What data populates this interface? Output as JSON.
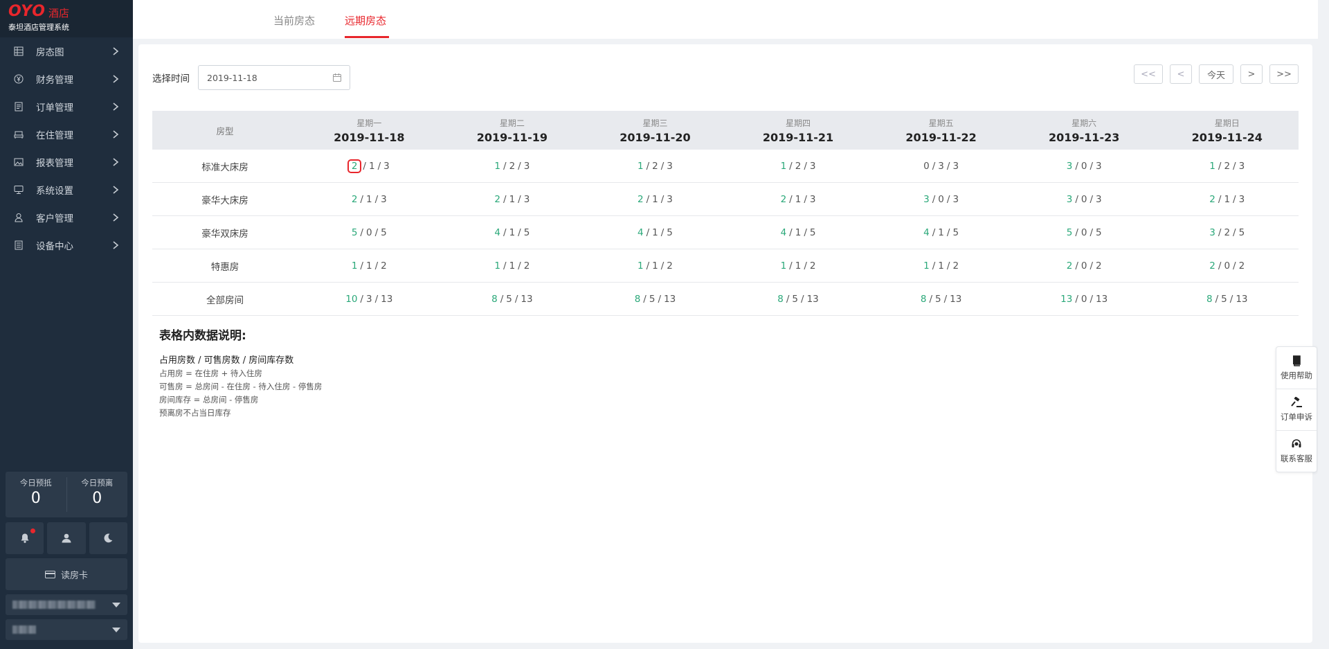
{
  "brand": {
    "logo_text": "OYO",
    "logo_suffix": "酒店",
    "subtitle": "泰坦酒店管理系统"
  },
  "sidebar": {
    "items": [
      {
        "label": "房态图",
        "icon": "grid-icon"
      },
      {
        "label": "财务管理",
        "icon": "yen-icon"
      },
      {
        "label": "订单管理",
        "icon": "document-icon"
      },
      {
        "label": "在住管理",
        "icon": "bed-icon"
      },
      {
        "label": "报表管理",
        "icon": "image-icon"
      },
      {
        "label": "系统设置",
        "icon": "monitor-icon"
      },
      {
        "label": "客户管理",
        "icon": "user-icon"
      },
      {
        "label": "设备中心",
        "icon": "list-icon"
      }
    ],
    "stats": {
      "checkin_label": "今日预抵",
      "checkin_value": "0",
      "checkout_label": "今日预离",
      "checkout_value": "0"
    },
    "read_card_label": "读房卡"
  },
  "tabs": [
    {
      "label": "当前房态",
      "active": false
    },
    {
      "label": "远期房态",
      "active": true
    }
  ],
  "toolbar": {
    "date_label": "选择时间",
    "date_value": "2019-11-18",
    "nav": {
      "first": "<<",
      "prev": "<",
      "today": "今天",
      "next": ">",
      "last": ">>"
    }
  },
  "table": {
    "type_header": "房型",
    "days": [
      {
        "weekday": "星期一",
        "date": "2019-11-18"
      },
      {
        "weekday": "星期二",
        "date": "2019-11-19"
      },
      {
        "weekday": "星期三",
        "date": "2019-11-20"
      },
      {
        "weekday": "星期四",
        "date": "2019-11-21"
      },
      {
        "weekday": "星期五",
        "date": "2019-11-22"
      },
      {
        "weekday": "星期六",
        "date": "2019-11-23"
      },
      {
        "weekday": "星期日",
        "date": "2019-11-24"
      }
    ],
    "rows": [
      {
        "type": "标准大床房",
        "cells": [
          [
            "2",
            "1",
            "3"
          ],
          [
            "1",
            "2",
            "3"
          ],
          [
            "1",
            "2",
            "3"
          ],
          [
            "1",
            "2",
            "3"
          ],
          [
            "0",
            "3",
            "3"
          ],
          [
            "3",
            "0",
            "3"
          ],
          [
            "1",
            "2",
            "3"
          ]
        ]
      },
      {
        "type": "豪华大床房",
        "cells": [
          [
            "2",
            "1",
            "3"
          ],
          [
            "2",
            "1",
            "3"
          ],
          [
            "2",
            "1",
            "3"
          ],
          [
            "2",
            "1",
            "3"
          ],
          [
            "3",
            "0",
            "3"
          ],
          [
            "3",
            "0",
            "3"
          ],
          [
            "2",
            "1",
            "3"
          ]
        ]
      },
      {
        "type": "豪华双床房",
        "cells": [
          [
            "5",
            "0",
            "5"
          ],
          [
            "4",
            "1",
            "5"
          ],
          [
            "4",
            "1",
            "5"
          ],
          [
            "4",
            "1",
            "5"
          ],
          [
            "4",
            "1",
            "5"
          ],
          [
            "5",
            "0",
            "5"
          ],
          [
            "3",
            "2",
            "5"
          ]
        ]
      },
      {
        "type": "特惠房",
        "cells": [
          [
            "1",
            "1",
            "2"
          ],
          [
            "1",
            "1",
            "2"
          ],
          [
            "1",
            "1",
            "2"
          ],
          [
            "1",
            "1",
            "2"
          ],
          [
            "1",
            "1",
            "2"
          ],
          [
            "2",
            "0",
            "2"
          ],
          [
            "2",
            "0",
            "2"
          ]
        ]
      },
      {
        "type": "全部房间",
        "cells": [
          [
            "10",
            "3",
            "13"
          ],
          [
            "8",
            "5",
            "13"
          ],
          [
            "8",
            "5",
            "13"
          ],
          [
            "8",
            "5",
            "13"
          ],
          [
            "8",
            "5",
            "13"
          ],
          [
            "13",
            "0",
            "13"
          ],
          [
            "8",
            "5",
            "13"
          ]
        ]
      }
    ]
  },
  "legend": {
    "title": "表格内数据说明:",
    "formula": "占用房数 / 可售房数 / 房间库存数",
    "lines": [
      "占用房 = 在住房 + 待入住房",
      "可售房 = 总房间 - 在住房 - 待入住房 - 停售房",
      "房间库存 = 总房间 - 停售房",
      "预离房不占当日库存"
    ]
  },
  "float_tools": [
    {
      "label": "使用帮助",
      "icon": "book-icon"
    },
    {
      "label": "订单申诉",
      "icon": "gavel-icon"
    },
    {
      "label": "联系客服",
      "icon": "headset-icon"
    }
  ],
  "colors": {
    "accent": "#e8262c",
    "occupied": "#2aa879",
    "sidebar_bg": "#1f2d3d"
  }
}
